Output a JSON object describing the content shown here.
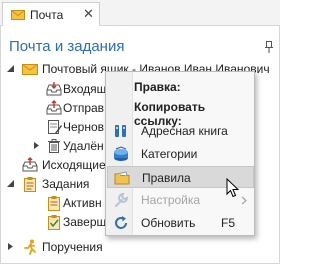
{
  "tab": {
    "label": "Почта",
    "close_glyph": "✕",
    "icon": "envelope-icon"
  },
  "panel": {
    "title": "Почта и задания",
    "pin_icon": "pin-icon"
  },
  "tree": {
    "mailbox": "Почтовый ящик - Иванов Иван Иванович",
    "inbox": "Входящ",
    "sent": "Отправ",
    "drafts": "Чернов",
    "deleted": "Удалён",
    "outgoing": "Исходящие",
    "tasks": "Задания",
    "tasks_active": "Активн",
    "tasks_done": "Заверш",
    "assignments": "Поручения"
  },
  "menu": {
    "header_rules": "Правка:",
    "header_copy_link": "Копировать ссылку:",
    "items": [
      {
        "label": "Адресная книга",
        "icon": "address-book-icon",
        "enabled": true
      },
      {
        "label": "Категории",
        "icon": "categories-icon",
        "enabled": true
      },
      {
        "label": "Правила",
        "icon": "folder-icon",
        "enabled": true,
        "highlighted": true
      },
      {
        "label": "Настройка",
        "icon": "wrench-icon",
        "enabled": false,
        "has_submenu": true
      },
      {
        "label": "Обновить",
        "icon": "refresh-icon",
        "enabled": true,
        "shortcut": "F5"
      }
    ]
  },
  "colors": {
    "title": "#2a6ebb",
    "menu_hover": "#d9d9d9",
    "disabled_text": "#a5a5a5"
  }
}
